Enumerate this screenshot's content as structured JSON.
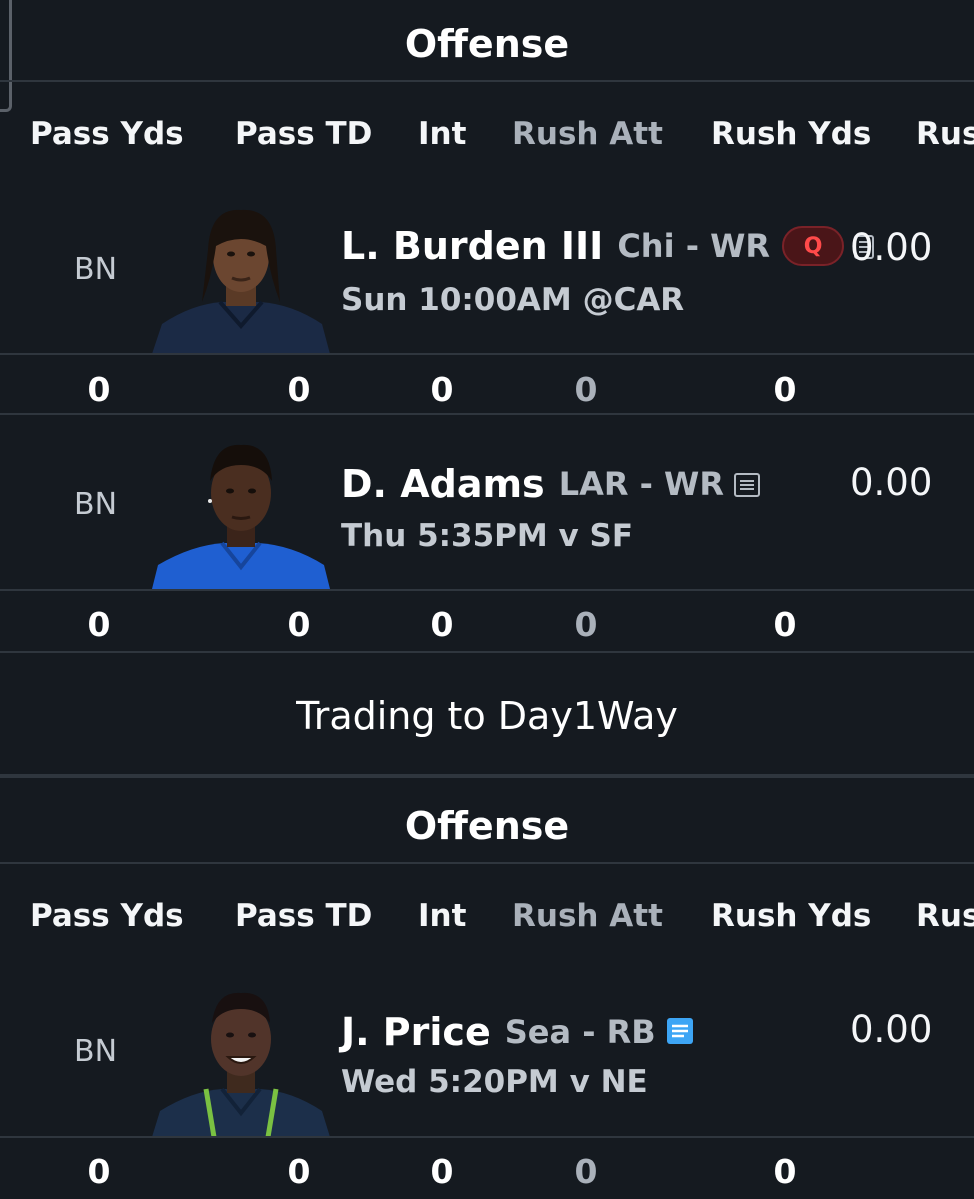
{
  "sections": [
    {
      "title": "Offense",
      "columns": [
        "Pass Yds",
        "Pass TD",
        "Int",
        "Rush Att",
        "Rush Yds",
        "Rus"
      ],
      "players": [
        {
          "slot": "BN",
          "name": "L. Burden III",
          "team_pos": "Chi - WR",
          "badge": "Q",
          "game": "Sun 10:00AM @CAR",
          "score": "0.00",
          "stats": [
            "0",
            "0",
            "0",
            "0",
            "0"
          ],
          "jersey_color": "#1b2a45",
          "note_icon": "note-icon-gray"
        },
        {
          "slot": "BN",
          "name": "D. Adams",
          "team_pos": "LAR - WR",
          "game": "Thu 5:35PM v SF",
          "score": "0.00",
          "stats": [
            "0",
            "0",
            "0",
            "0",
            "0"
          ],
          "jersey_color": "#1f5fd1",
          "note_icon": "note-icon-gray"
        }
      ]
    },
    {
      "title": "Offense",
      "columns": [
        "Pass Yds",
        "Pass TD",
        "Int",
        "Rush Att",
        "Rush Yds",
        "Rus"
      ],
      "players": [
        {
          "slot": "BN",
          "name": "J. Price",
          "team_pos": "Sea - RB",
          "game": "Wed 5:20PM v NE",
          "score": "0.00",
          "stats": [
            "0",
            "0",
            "0",
            "0",
            "0"
          ],
          "jersey_color": "#1c2f4a",
          "note_icon": "note-icon-blue"
        }
      ]
    }
  ],
  "trading_label": "Trading to Day1Way",
  "colors": {
    "background": "#151a20",
    "divider": "#2f363e",
    "injury_badge": "#ff4a4a",
    "note_active": "#3da5f5"
  }
}
